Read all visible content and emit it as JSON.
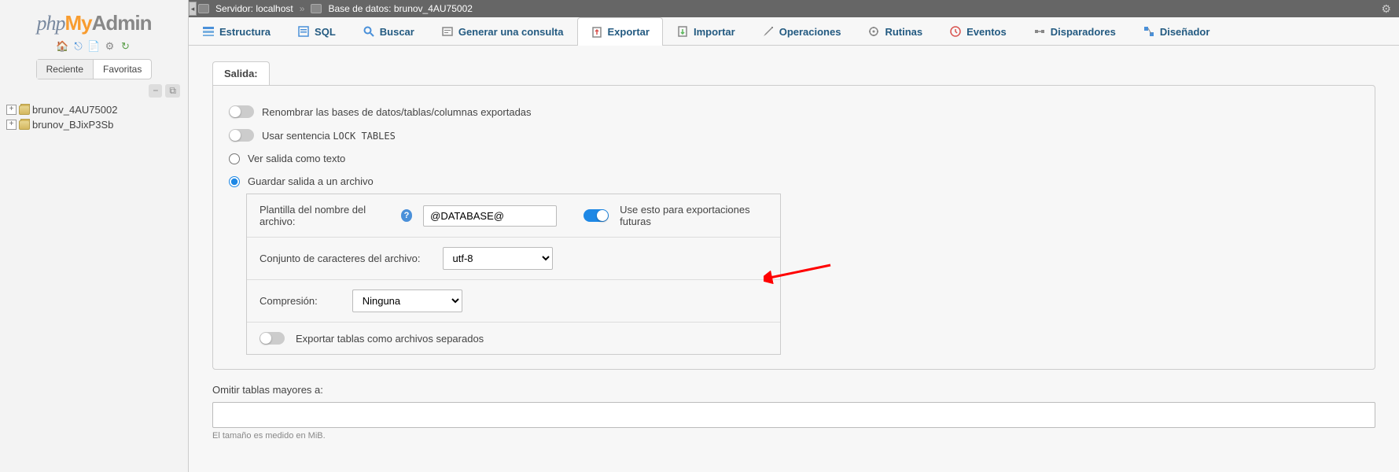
{
  "logo": {
    "part1": "php",
    "part2": "My",
    "part3": "Admin"
  },
  "sidebar": {
    "tabs": {
      "recent": "Reciente",
      "favorites": "Favoritas"
    },
    "databases": [
      "brunov_4AU75002",
      "brunov_BJixP3Sb"
    ]
  },
  "breadcrumb": {
    "server_label": "Servidor:",
    "server_value": "localhost",
    "db_label": "Base de datos:",
    "db_value": "brunov_4AU75002"
  },
  "tabs": [
    {
      "label": "Estructura",
      "icon": "structure"
    },
    {
      "label": "SQL",
      "icon": "sql"
    },
    {
      "label": "Buscar",
      "icon": "search"
    },
    {
      "label": "Generar una consulta",
      "icon": "query"
    },
    {
      "label": "Exportar",
      "icon": "export",
      "active": true
    },
    {
      "label": "Importar",
      "icon": "import"
    },
    {
      "label": "Operaciones",
      "icon": "operations"
    },
    {
      "label": "Rutinas",
      "icon": "routines"
    },
    {
      "label": "Eventos",
      "icon": "events"
    },
    {
      "label": "Disparadores",
      "icon": "triggers"
    },
    {
      "label": "Diseñador",
      "icon": "designer"
    }
  ],
  "output": {
    "section_title": "Salida:",
    "rename_label": "Renombrar las bases de datos/tablas/columnas exportadas",
    "lock_tables_prefix": "Usar sentencia ",
    "lock_tables_code": "LOCK TABLES",
    "view_as_text": "Ver salida como texto",
    "save_to_file": "Guardar salida a un archivo",
    "filename_template_label": "Plantilla del nombre del archivo:",
    "filename_template_value": "@DATABASE@",
    "filename_future_label": "Use esto para exportaciones futuras",
    "charset_label": "Conjunto de caracteres del archivo:",
    "charset_value": "utf-8",
    "compression_label": "Compresión:",
    "compression_value": "Ninguna",
    "separate_files_label": "Exportar tablas como archivos separados",
    "skip_tables_label": "Omitir tablas mayores a:",
    "skip_tables_hint": "El tamaño es medido en MiB."
  }
}
